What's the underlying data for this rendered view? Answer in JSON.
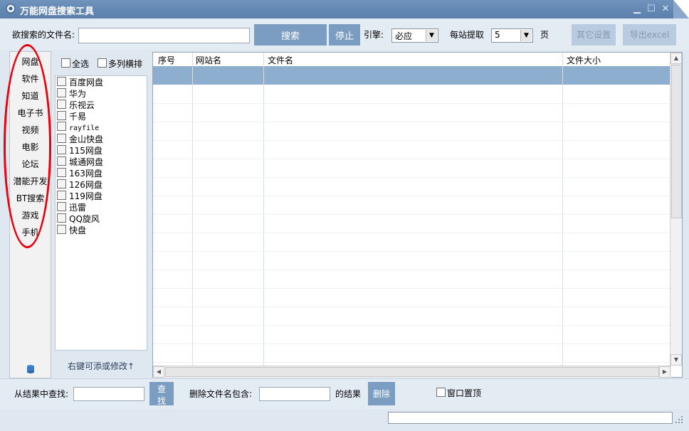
{
  "window": {
    "title": "万能网盘搜索工具"
  },
  "toolbar": {
    "search_label": "欲搜索的文件名:",
    "search_value": "",
    "search_button": "搜索",
    "stop_button": "停止",
    "engine_label": "引擎:",
    "engine_value": "必应",
    "per_site_label": "每站提取",
    "per_site_value": "5",
    "page_unit": "页",
    "settings_button": "其它设置",
    "export_button": "导出excel"
  },
  "categories": [
    "网盘",
    "软件",
    "知道",
    "电子书",
    "视频",
    "电影",
    "论坛",
    "潜能开发",
    "BT搜索",
    "游戏",
    "手机"
  ],
  "site_panel": {
    "select_all": "全选",
    "multi_column": "多列横排",
    "sites": [
      "百度网盘",
      "华为",
      "乐视云",
      "千易",
      "rayfile",
      "金山快盘",
      "115网盘",
      "城通网盘",
      "163网盘",
      "126网盘",
      "119网盘",
      "迅雷",
      "QQ旋风",
      "快盘"
    ],
    "hint": "右键可添或修改↑"
  },
  "grid": {
    "columns": [
      "序号",
      "网站名",
      "文件名",
      "文件大小"
    ],
    "rows": []
  },
  "bottom": {
    "filter_label": "从结果中查找:",
    "filter_value": "",
    "find_button": "查找",
    "delete_label": "删除文件名包含:",
    "delete_value": "",
    "result_label": "的结果",
    "delete_button": "删除",
    "topmost_label": "窗口置顶"
  },
  "colors": {
    "titlebar": "#5f84b1",
    "accent_button": "#7c9dc2",
    "selected_row": "#8eaed0",
    "annotation": "#e8000c"
  }
}
